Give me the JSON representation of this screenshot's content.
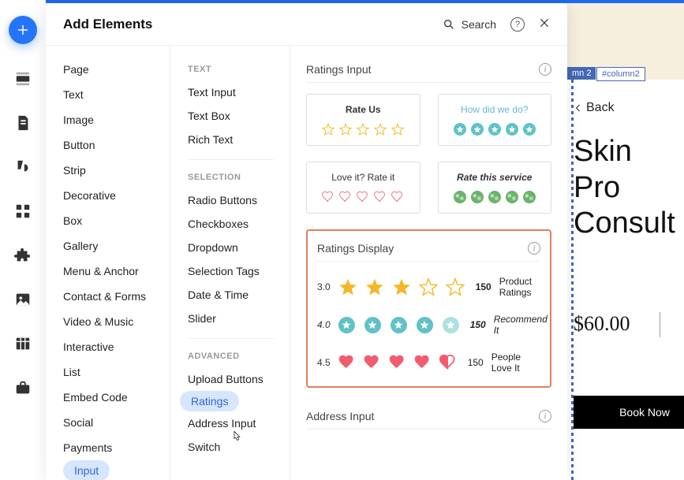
{
  "panel": {
    "title": "Add Elements",
    "search": "Search"
  },
  "col1": [
    "Page",
    "Text",
    "Image",
    "Button",
    "Strip",
    "Decorative",
    "Box",
    "Gallery",
    "Menu & Anchor",
    "Contact & Forms",
    "Video & Music",
    "Interactive",
    "List",
    "Embed Code",
    "Social",
    "Payments",
    "Input"
  ],
  "col2": {
    "groups": [
      {
        "head": "TEXT",
        "items": [
          "Text Input",
          "Text Box",
          "Rich Text"
        ]
      },
      {
        "head": "SELECTION",
        "items": [
          "Radio Buttons",
          "Checkboxes",
          "Dropdown",
          "Selection Tags",
          "Date & Time",
          "Slider"
        ]
      },
      {
        "head": "ADVANCED",
        "items": [
          "Upload Buttons",
          "Ratings",
          "Address Input",
          "Switch"
        ]
      }
    ],
    "selected": "Ratings"
  },
  "ratings_input": {
    "title": "Ratings Input",
    "cards": [
      {
        "label": "Rate Us",
        "style": "b"
      },
      {
        "label": "How did we do?",
        "style": "blue"
      },
      {
        "label": "Love it? Rate it",
        "style": ""
      },
      {
        "label": "Rate this service",
        "style": "it"
      }
    ]
  },
  "ratings_display": {
    "title": "Ratings Display",
    "rows": [
      {
        "value": "3.0",
        "count": "150",
        "label": "Product Ratings"
      },
      {
        "value": "4.0",
        "count": "150",
        "label": "Recommend It"
      },
      {
        "value": "4.5",
        "count": "150",
        "label": "People Love It"
      }
    ]
  },
  "address_input": {
    "title": "Address Input"
  },
  "canvas": {
    "tag1": "mn 2",
    "tag2": "#column2",
    "back": "Back",
    "title_l1": "Skin Pro",
    "title_l2": "Consult",
    "price": "$60.00",
    "book": "Book Now"
  }
}
